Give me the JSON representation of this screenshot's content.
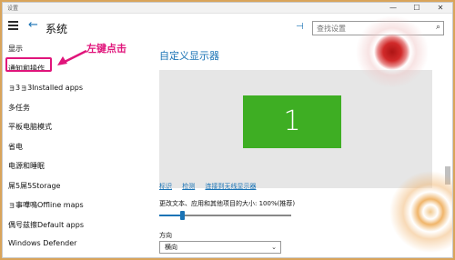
{
  "window": {
    "title": "设置",
    "minimize": "—",
    "maximize": "☐",
    "close": "✕"
  },
  "header": {
    "back_glyph": "←",
    "page_title": "系统",
    "pin_glyph": "⊣",
    "search_placeholder": "查找设置",
    "search_glyph": "⌕"
  },
  "sidebar": {
    "items": [
      {
        "label": "显示"
      },
      {
        "label": "通知和操作"
      },
      {
        "label": "ョ3ョ3Installed apps"
      },
      {
        "label": "多任务"
      },
      {
        "label": "平板电脑模式"
      },
      {
        "label": "省电"
      },
      {
        "label": "电源和睡眠"
      },
      {
        "label": "屌5屌5Storage"
      },
      {
        "label": "ョ事嘩鳴Offline maps"
      },
      {
        "label": "偶号兹擦Default apps"
      },
      {
        "label": "Windows Defender"
      }
    ]
  },
  "annotation": {
    "text": "左键点击",
    "color": "#e0157b"
  },
  "main": {
    "section_title": "自定义显示器",
    "monitor_number": "1",
    "links": [
      "标识",
      "检测",
      "连接到无线显示器"
    ],
    "scale_label": "更改文本、应用和其他项目的大小: 100%(推荐)",
    "scale_fraction": 0.17,
    "orientation_label": "方向",
    "orientation_value": "横向",
    "chevron_glyph": "⌄"
  },
  "colors": {
    "accent": "#1a73b5",
    "monitor": "#3eae23",
    "annotation": "#e0157b"
  }
}
